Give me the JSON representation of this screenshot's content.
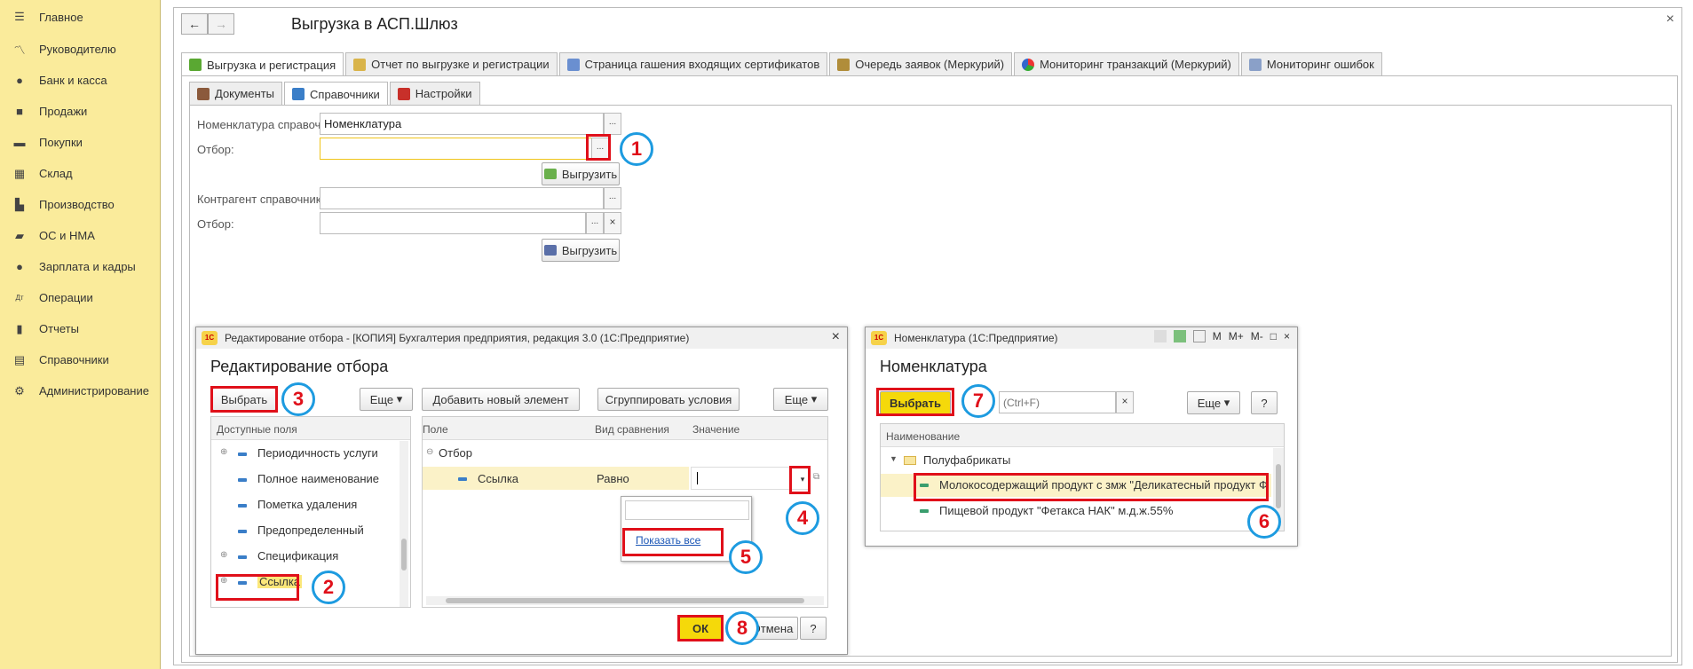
{
  "sidebar": {
    "items": [
      {
        "label": "Главное",
        "icon": "menu-icon"
      },
      {
        "label": "Руководителю",
        "icon": "chart-line-icon"
      },
      {
        "label": "Банк и касса",
        "icon": "coin-icon"
      },
      {
        "label": "Продажи",
        "icon": "bag-icon"
      },
      {
        "label": "Покупки",
        "icon": "cart-icon"
      },
      {
        "label": "Склад",
        "icon": "warehouse-icon"
      },
      {
        "label": "Производство",
        "icon": "factory-icon"
      },
      {
        "label": "ОС и НМА",
        "icon": "truck-icon"
      },
      {
        "label": "Зарплата и кадры",
        "icon": "person-icon"
      },
      {
        "label": "Операции",
        "icon": "dt-kt-icon"
      },
      {
        "label": "Отчеты",
        "icon": "bar-chart-icon"
      },
      {
        "label": "Справочники",
        "icon": "books-icon"
      },
      {
        "label": "Администрирование",
        "icon": "gear-icon"
      }
    ]
  },
  "window": {
    "title": "Выгрузка в АСП.Шлюз",
    "back": "←",
    "forward": "→",
    "close": "×"
  },
  "top_tabs": [
    "Выгрузка и регистрация",
    "Отчет по выгрузке и регистрации",
    "Страница гашения входящих сертификатов",
    "Очередь заявок (Меркурий)",
    "Мониторинг транзакций (Меркурий)",
    "Мониторинг ошибок"
  ],
  "sub_tabs": [
    "Документы",
    "Справочники",
    "Настройки"
  ],
  "form": {
    "nomenclature_label": "Номенклатура справочник:",
    "nomenclature_value": "Номенклатура",
    "filter_label": "Отбор:",
    "upload_btn": "Выгрузить",
    "contractor_label": "Контрагент справочник:",
    "filter2_label": "Отбор:",
    "upload_btn2": "Выгрузить",
    "ellipsis": "...",
    "clear": "×"
  },
  "filter_dialog": {
    "titlebar": "Редактирование отбора - [КОПИЯ] Бухгалтерия предприятия, редакция 3.0  (1С:Предприятие)",
    "logo": "1С",
    "heading": "Редактирование отбора",
    "choose_btn": "Выбрать",
    "more_btn": "Еще",
    "add_btn": "Добавить новый элемент",
    "group_btn": "Сгруппировать условия",
    "more_btn2": "Еще",
    "available_fields_header": "Доступные поля",
    "fields": [
      "Периодичность услуги",
      "Полное наименование",
      "Пометка удаления",
      "Предопределенный",
      "Спецификация",
      "Ссылка"
    ],
    "col_field": "Поле",
    "col_compare": "Вид сравнения",
    "col_value": "Значение",
    "group_row": "Отбор",
    "cond_field": "Ссылка",
    "cond_compare": "Равно",
    "show_all": "Показать все",
    "ok_btn": "ОК",
    "cancel_btn": "Отмена",
    "help_btn": "?"
  },
  "nom_dialog": {
    "titlebar": "Номенклатура  (1С:Предприятие)",
    "logo": "1С",
    "heading": "Номенклатура",
    "choose_btn": "Выбрать",
    "search_placeholder": "(Ctrl+F)",
    "more_btn": "Еще",
    "help_btn": "?",
    "col_name": "Наименование",
    "folder": "Полуфабрикаты",
    "items": [
      "Молокосодержащий продукт с змж \"Деликатесный продукт Ф",
      "Пищевой продукт \"Фетакса НАК\" м.д.ж.55%"
    ],
    "tb_buttons": [
      "M",
      "M+",
      "M-",
      "□",
      "×"
    ]
  },
  "step_markers": [
    "1",
    "2",
    "3",
    "4",
    "5",
    "6",
    "7",
    "8"
  ],
  "colors": {
    "sidebar_bg": "#faeb9b",
    "highlight_red": "#e0101a",
    "marker_blue": "#1d9be0",
    "default_btn": "#f5d90a",
    "active_field": "#f0c419"
  }
}
